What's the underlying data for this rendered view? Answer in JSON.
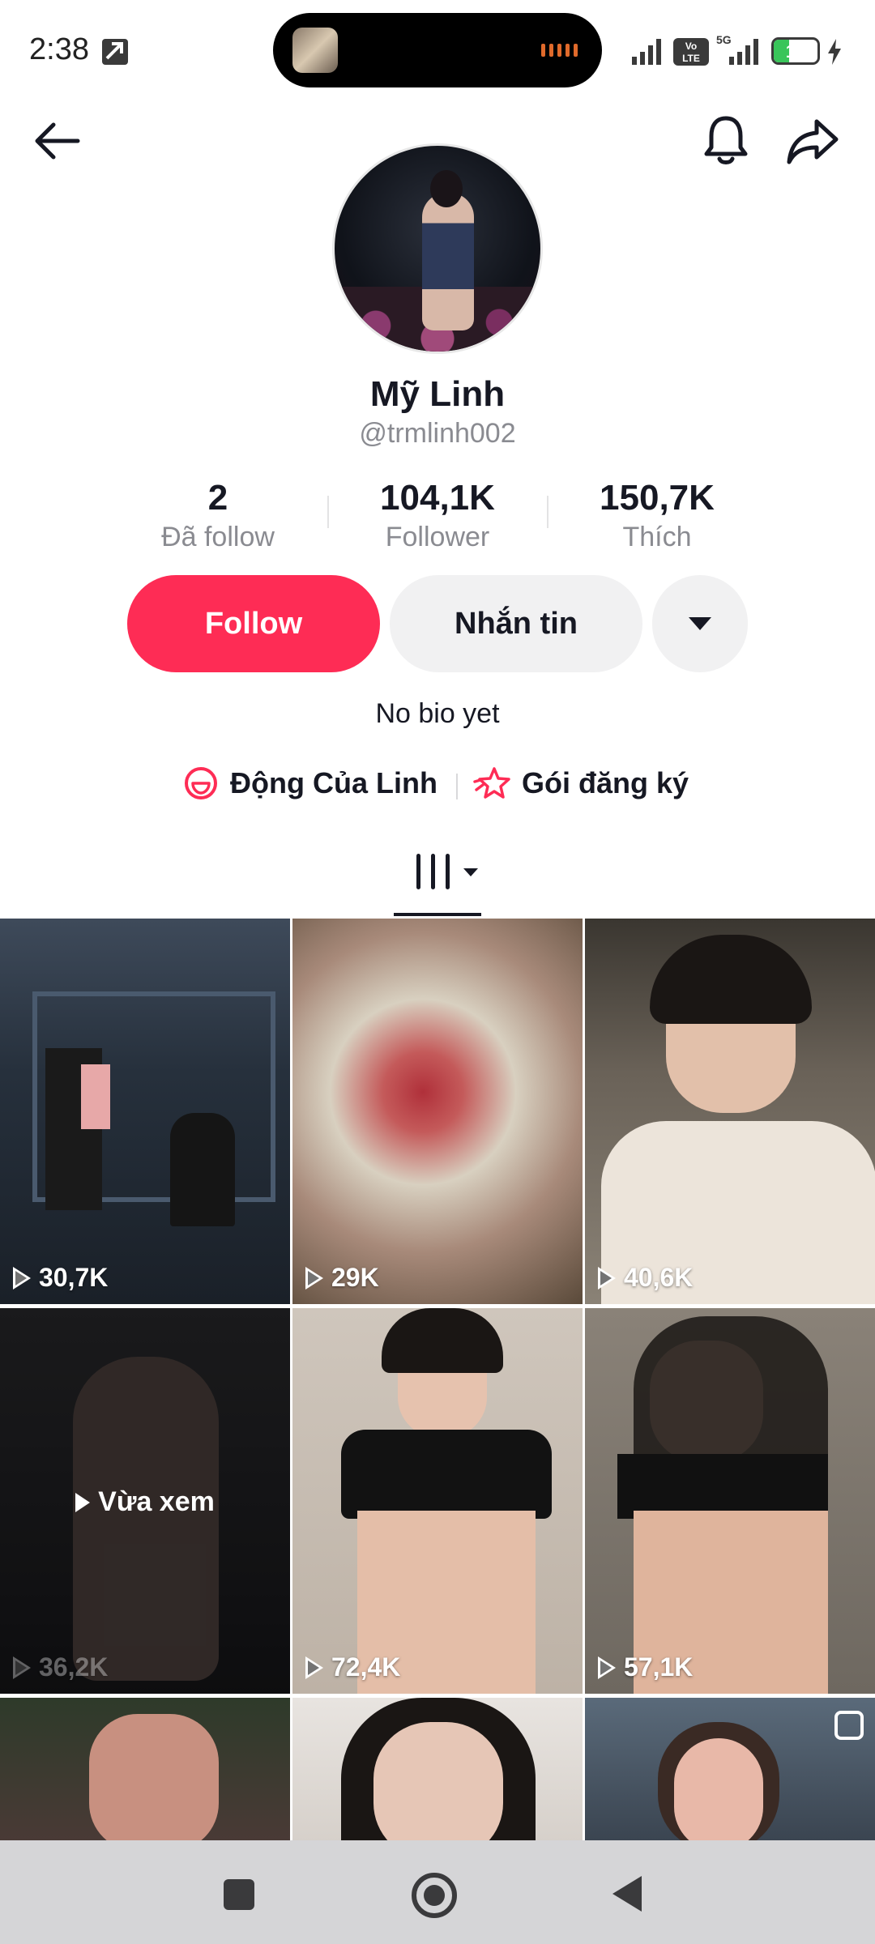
{
  "status_bar": {
    "time": "2:38",
    "battery": "18",
    "network_5g": "5G",
    "volte": "VoLTE"
  },
  "header": {
    "back_icon": "arrow-left-icon",
    "bell_icon": "bell-icon",
    "share_icon": "share-arrow-icon"
  },
  "profile": {
    "display_name": "Mỹ Linh",
    "username": "@trmlinh002",
    "bio": "No bio yet"
  },
  "stats": [
    {
      "value": "2",
      "label": "Đã follow"
    },
    {
      "value": "104,1K",
      "label": "Follower"
    },
    {
      "value": "150,7K",
      "label": "Thích"
    }
  ],
  "actions": {
    "follow_label": "Follow",
    "message_label": "Nhắn tin",
    "follow_color": "#fe2c55"
  },
  "links": {
    "community_label": "Động Của Linh",
    "subscription_label": "Gói đăng ký"
  },
  "videos": [
    {
      "views": "30,7K"
    },
    {
      "views": "29K"
    },
    {
      "views": "40,6K"
    },
    {
      "views": "36,2K",
      "watched_label": "Vừa xem"
    },
    {
      "views": "72,4K"
    },
    {
      "views": "57,1K"
    },
    {
      "views": ""
    },
    {
      "views": ""
    },
    {
      "views": ""
    }
  ]
}
